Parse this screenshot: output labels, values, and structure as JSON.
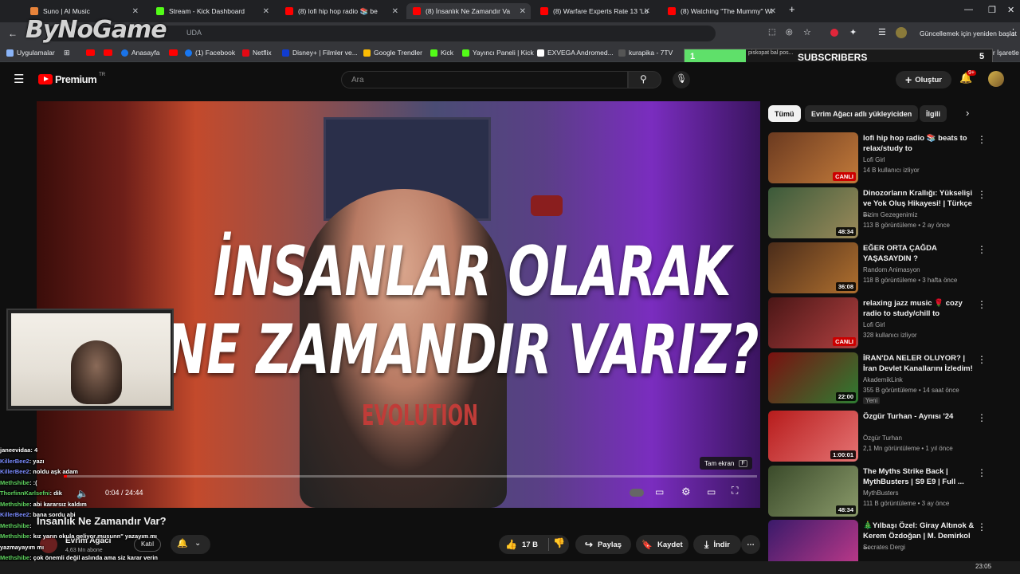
{
  "tabs": [
    {
      "title": "Suno | AI Music",
      "color": "#e8833a"
    },
    {
      "title": "Stream - Kick Dashboard",
      "color": "#53fc18"
    },
    {
      "title": "(8) lofi hip hop radio 📚 be",
      "color": "#ff0000"
    },
    {
      "title": "(8) İnsanlık Ne Zamandır Va",
      "color": "#ff0000",
      "active": true
    },
    {
      "title": "(8) Warfare Experts Rate 13 'Lo",
      "color": "#ff0000"
    },
    {
      "title": "(8) Watching \"The Mummy\" Wi",
      "color": "#ff0000"
    }
  ],
  "watermark": "ByNoGame",
  "url_fragment": "UDA",
  "update_button": "Güncellemek için yeniden başlat",
  "bookmarks": [
    {
      "label": "Uygulamalar",
      "color": "#8ab4f8"
    },
    {
      "label": "Anasayfa",
      "color": "#1a73e8"
    },
    {
      "label": "(1) Facebook",
      "color": "#1877f2"
    },
    {
      "label": "Netflix",
      "color": "#e50914"
    },
    {
      "label": "Disney+ | Filmler ve...",
      "color": "#113ccf"
    },
    {
      "label": "Google Trendler",
      "color": "#fbbc04"
    },
    {
      "label": "Kick",
      "color": "#53fc18"
    },
    {
      "label": "Yayıncı Paneli | Kick",
      "color": "#53fc18"
    },
    {
      "label": "EXVEGA Andromed...",
      "color": "#ffffff"
    },
    {
      "label": "kurapika - 7TV",
      "color": "#2b2b2b"
    }
  ],
  "bookmark_hidden": "piskopat bal pos...",
  "bookmark_right": "Tüm Yer İşaretle",
  "subscribers": {
    "label": "SUBSCRIBERS",
    "current": "1",
    "goal": "5",
    "fraction": 0.2
  },
  "youtube": {
    "logo": "Premium",
    "logo_badge": "TR",
    "search_placeholder": "Ara",
    "create_label": "Oluştur",
    "notif_count": "9+"
  },
  "video": {
    "title_line1": "İNSANLAR OLARAK",
    "title_line2": "NE ZAMANDIR VARIZ?",
    "shirt": "EVOLUTION",
    "time": "0:04 / 24:44",
    "fullscreen_tooltip": "Tam ekran",
    "fullscreen_key": "F",
    "progress": 0.003
  },
  "below": {
    "title": "İnsanlık Ne Zamandır Var?",
    "channel": "Evrim Ağacı",
    "subs": "4,63 Mn abone",
    "join": "Katıl",
    "likes": "17 B",
    "share": "Paylaş",
    "save": "Kaydet",
    "download": "İndir"
  },
  "chat": [
    {
      "user": "janeevidaa",
      "msg": ": 4",
      "color": "#ffffff"
    },
    {
      "user": "KillerBee2",
      "msg": ": yazı",
      "color": "#7b8cff"
    },
    {
      "user": "KillerBee2",
      "msg": ": noldu aşk adam",
      "color": "#7b8cff"
    },
    {
      "user": "Methshibe",
      "msg": ": :(",
      "color": "#5fd35f"
    },
    {
      "user": "ThorfinnKarlsefni",
      "msg": ": dik",
      "color": "#5fd35f"
    },
    {
      "user": "Methshibe",
      "msg": ": abi kararsız kaldım",
      "color": "#5fd35f"
    },
    {
      "user": "KillerBee2",
      "msg": ": bana sordu abi",
      "color": "#7b8cff"
    },
    {
      "user": "Methshibe",
      "msg": ": ",
      "color": "#5fd35f"
    },
    {
      "user": "Methshibe",
      "msg": ": kız yarın okula geliyor musunn\" yazayım mı",
      "color": "#5fd35f"
    },
    {
      "user": "",
      "msg": "yazmayayım mı",
      "color": "#ffffff"
    },
    {
      "user": "Methshibe",
      "msg": ": çok önemli değil aslında ama siz karar verin",
      "color": "#5fd35f"
    },
    {
      "user": "ThorfinnKarlsefni",
      "msg": ": yaz",
      "color": "#5fd35f"
    }
  ],
  "chips": [
    {
      "label": "Tümü",
      "active": true
    },
    {
      "label": "Evrim Ağacı adlı yükleyiciden",
      "active": false
    },
    {
      "label": "İlgili",
      "active": false
    }
  ],
  "recommendations": [
    {
      "title": "lofi hip hop radio 📚 beats to relax/study to",
      "channel": "Lofi Girl",
      "meta": "14 B kullanıcı izliyor",
      "badge": "CANLI",
      "live": true,
      "colors": [
        "#6b3a20",
        "#c27a3a"
      ]
    },
    {
      "title": "Dinozorların Krallığı: Yükselişi ve Yok Oluş Hikayesi! | Türkçe ...",
      "channel": "Bizim Gezegenimiz",
      "meta": "113 B görüntüleme • 2 ay önce",
      "badge": "48:34",
      "live": false,
      "colors": [
        "#3b5a3a",
        "#9b8a5a"
      ]
    },
    {
      "title": "EĞER ORTA ÇAĞDA YAŞASAYDIN ?",
      "channel": "Random Animasyon",
      "meta": "118 B görüntüleme • 3 hafta önce",
      "badge": "36:08",
      "live": false,
      "colors": [
        "#4a2c1a",
        "#b0702f"
      ]
    },
    {
      "title": "relaxing jazz music 🌹 cozy radio to study/chill to",
      "channel": "Lofi Girl",
      "meta": "328 kullanıcı izliyor",
      "badge": "CANLI",
      "live": true,
      "colors": [
        "#4a1616",
        "#b04040"
      ]
    },
    {
      "title": "İRAN'DA NELER OLUYOR? | İran Devlet Kanallarını İzledim!",
      "channel": "AkademikLink",
      "meta": "355 B görüntüleme • 14 saat önce",
      "extra": "Yeni",
      "badge": "22:00",
      "live": false,
      "colors": [
        "#7a1010",
        "#2e7d32"
      ]
    },
    {
      "title": "Özgür Turhan - Aynısı '24",
      "channel": "Özgür Turhan",
      "meta": "2,1 Mn görüntüleme • 1 yıl önce",
      "badge": "1:00:01",
      "live": false,
      "colors": [
        "#b71c1c",
        "#e57373"
      ]
    },
    {
      "title": "The Myths Strike Back | MythBusters | S9 E9 | Full ...",
      "channel": "MythBusters",
      "meta": "111 B görüntüleme • 3 ay önce",
      "badge": "48:34",
      "live": false,
      "colors": [
        "#3a4a2a",
        "#8a9a6a"
      ]
    },
    {
      "title": "🎄Yılbaşı Özel: Giray Altınok & Kerem Özdoğan | M. Demirkol ...",
      "channel": "Socrates Dergi",
      "meta": "",
      "badge": "",
      "live": false,
      "colors": [
        "#3a1a6a",
        "#c03a8a"
      ]
    }
  ],
  "clock": "23:05"
}
